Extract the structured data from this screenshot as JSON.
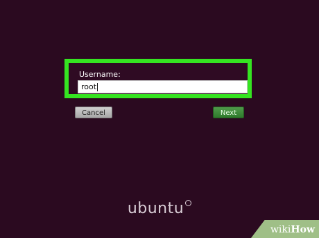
{
  "login": {
    "username_label": "Username:",
    "username_value": "root",
    "cancel_label": "Cancel",
    "next_label": "Next"
  },
  "branding": {
    "logo_text": "ubuntu",
    "watermark_wiki": "wiki",
    "watermark_how": "How"
  },
  "colors": {
    "background": "#2b0a20",
    "highlight": "#35e421",
    "next_button": "#3d8a39"
  }
}
